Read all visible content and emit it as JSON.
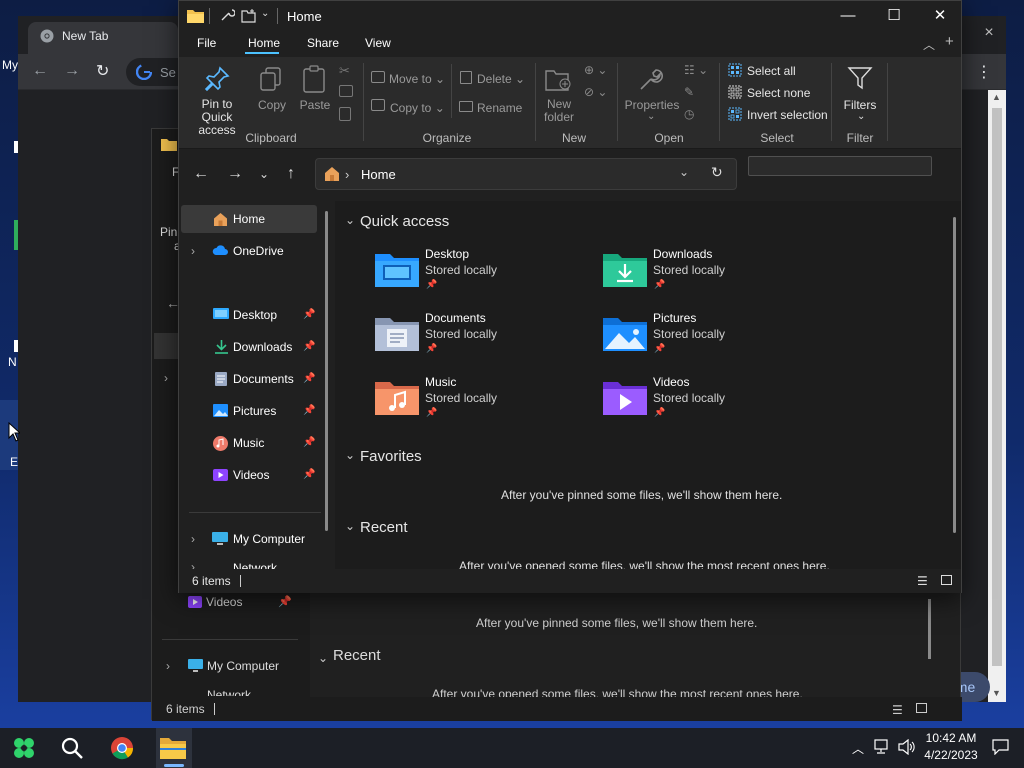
{
  "desktop": {
    "label_my": "My",
    "label_n": "N",
    "label_e": "E"
  },
  "chrome": {
    "tab_title": "New Tab",
    "omnibox_placeholder": "Se",
    "pill_text": "ome",
    "close_glyph": "×",
    "menu_glyph": "⋮"
  },
  "bg_explorer": {
    "ribbon_letters": "F",
    "pin_label": "Pin",
    "pin_label_b": "a",
    "videos_label": "Videos",
    "my_computer_label": "My Computer",
    "network_label": "Network",
    "pinned_msg": "After you've pinned some files, we'll show them here.",
    "recent_heading": "Recent",
    "recent_msg": "After you've opened some files, we'll show the most recent ones here.",
    "status_text": "6 items"
  },
  "explorer": {
    "title": "Home",
    "window_controls": {
      "minimize": "—",
      "maximize": "☐",
      "close": "✕"
    },
    "menu_tabs": [
      "File",
      "Home",
      "Share",
      "View"
    ],
    "ribbon": {
      "clipboard": {
        "name": "Clipboard",
        "pin_line1": "Pin to Quick",
        "pin_line2": "access",
        "copy": "Copy",
        "paste": "Paste"
      },
      "organize": {
        "name": "Organize",
        "move_to": "Move to",
        "copy_to": "Copy to",
        "delete": "Delete",
        "rename": "Rename"
      },
      "new": {
        "name": "New",
        "new_folder_line1": "New",
        "new_folder_line2": "folder"
      },
      "open": {
        "name": "Open",
        "properties": "Properties"
      },
      "select": {
        "name": "Select",
        "select_all": "Select all",
        "select_none": "Select none",
        "invert": "Invert selection"
      },
      "filter": {
        "name": "Filter",
        "filters": "Filters"
      }
    },
    "address": {
      "crumb": "Home",
      "separator": "›",
      "search_placeholder": ""
    },
    "nav": {
      "home": "Home",
      "onedrive": "OneDrive",
      "desktop": "Desktop",
      "downloads": "Downloads",
      "documents": "Documents",
      "pictures": "Pictures",
      "music": "Music",
      "videos": "Videos",
      "my_computer": "My Computer",
      "network": "Network"
    },
    "quick_access": {
      "heading": "Quick access",
      "items": [
        {
          "name": "Desktop",
          "sub": "Stored locally"
        },
        {
          "name": "Downloads",
          "sub": "Stored locally"
        },
        {
          "name": "Documents",
          "sub": "Stored locally"
        },
        {
          "name": "Pictures",
          "sub": "Stored locally"
        },
        {
          "name": "Music",
          "sub": "Stored locally"
        },
        {
          "name": "Videos",
          "sub": "Stored locally"
        }
      ]
    },
    "favorites": {
      "heading": "Favorites",
      "msg": "After you've pinned some files, we'll show them here."
    },
    "recent": {
      "heading": "Recent",
      "msg": "After you've opened some files, we'll show the most recent ones here."
    },
    "status": "6 items"
  },
  "taskbar": {
    "time": "10:42 AM",
    "date": "4/22/2023"
  },
  "colors": {
    "accent": "#4cc2ff",
    "folder_yellow": "#f2c14e",
    "desktop_blue": "#1e90ff"
  }
}
